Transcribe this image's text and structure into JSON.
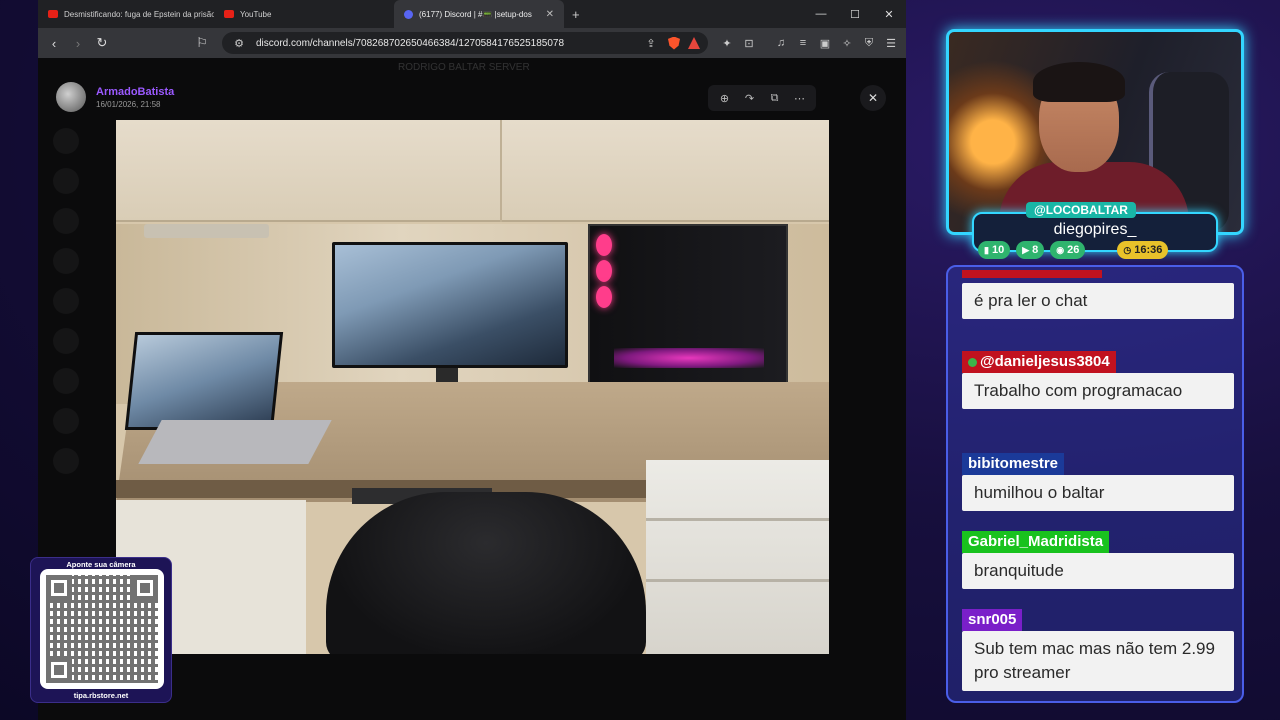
{
  "browser": {
    "tabs": [
      {
        "label": "Desmistificando: fuga de Epstein da prisão c",
        "icon": "youtube-icon"
      },
      {
        "label": "YouTube",
        "icon": "youtube-icon"
      },
      {
        "label": "(6177) Discord | #📟 |setup-dos-subs |",
        "icon": "discord-icon",
        "active": true
      }
    ],
    "new_tab": "+",
    "url": "discord.com/channels/708268702650466384/1270584176525185078"
  },
  "discord": {
    "server_name": "RODRIGO BALTAR SERVER",
    "channel": "setup-dos-subs",
    "viewer": {
      "author": "ArmadoBatista",
      "timestamp": "16/01/2026, 21:58"
    }
  },
  "qr": {
    "title": "Aponte sua câmera",
    "url": "tipa.rbstore.net"
  },
  "stream": {
    "handle": "@LOCOBALTAR",
    "display_name": "diegopires_",
    "stats": {
      "twitch": "10",
      "youtube": "8",
      "kick": "26",
      "time": "16:36"
    }
  },
  "chat": {
    "messages": [
      {
        "user": "",
        "text": "é pra ler o chat",
        "color": "#c1121f"
      },
      {
        "user": "@danieljesus3804",
        "text": "Trabalho com programacao",
        "color": "#c1121f"
      },
      {
        "user": "bibitomestre",
        "text": "humilhou o baltar",
        "color": "#1b3a99"
      },
      {
        "user": "Gabriel_Madridista",
        "text": "branquitude",
        "color": "#19c21e"
      },
      {
        "user": "snr005",
        "text": "Sub tem mac mas não tem 2.99 pro streamer",
        "color": "#7a1fc9"
      }
    ]
  }
}
